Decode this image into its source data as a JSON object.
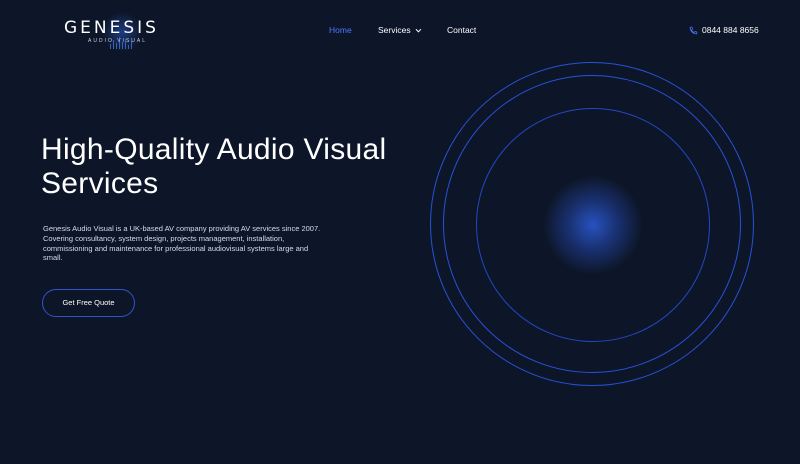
{
  "brand": {
    "name": "GENESIS",
    "tagline": "AUDIO VISUAL"
  },
  "nav": {
    "items": [
      {
        "label": "Home",
        "active": true
      },
      {
        "label": "Services",
        "has_dropdown": true
      },
      {
        "label": "Contact"
      }
    ]
  },
  "contact": {
    "phone": "0844 884 8656",
    "icon": "phone-icon"
  },
  "hero": {
    "title_line1": "High-Quality Audio Visual",
    "title_line2": "Services",
    "description": "Genesis Audio Visual is a UK-based AV company providing AV services since 2007. Covering consultancy, system design, projects management, installation, commissioning and maintenance for professional audiovisual systems large and small.",
    "cta_label": "Get Free Quote"
  },
  "colors": {
    "background": "#0d1628",
    "accent": "#2a50d6",
    "active_nav": "#4c77ff",
    "text": "#ffffff"
  }
}
